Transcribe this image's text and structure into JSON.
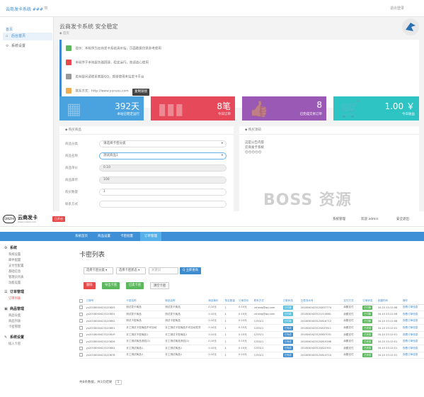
{
  "top_screen": {
    "header": {
      "logo": "云商发卡系统 ###",
      "menu_icon": "menu-icon",
      "right_text": "退出登录"
    },
    "sidebar": {
      "header": "首页",
      "items": [
        {
          "label": "后台首页",
          "active": true,
          "icon": "home-icon"
        },
        {
          "label": "系统设置",
          "active": false,
          "icon": "gear-icon"
        }
      ]
    },
    "page_title": "云商发卡系统 安全稳定",
    "breadcrumb": "◆ 首页",
    "notices": [
      {
        "text": "提示：本程序为云商发卡系统演示站，页面数据仅供参考使用",
        "color": "#5cb85c"
      },
      {
        "text": "本程序于本地服务器搭建，稳定运行，故请放心使用",
        "color": "#e64a4a"
      },
      {
        "text": "若有疑问请联系客服QQ，感谢使用本站发卡平台",
        "color": "#999999"
      },
      {
        "text": "联系方式：http://www.yunsos.com",
        "color": "#f0ad4e",
        "button": "复制链接"
      }
    ],
    "stats": [
      {
        "big": "392天",
        "small": "本站已稳定运行",
        "color": "#4aa3df",
        "icon": "calendar-icon"
      },
      {
        "big": "8笔",
        "small": "今日订单",
        "color": "#e64a5a",
        "icon": "chart-icon"
      },
      {
        "big": "8",
        "small": "已完成交易订单",
        "color": "#9b59b6",
        "icon": "thumb-icon"
      },
      {
        "big": "1.00 ￥",
        "small": "今日收益",
        "color": "#2ec4c4",
        "icon": "cart-icon"
      }
    ],
    "form_panel": {
      "title": "◆ 购买商品",
      "rows": [
        {
          "label": "商品分类",
          "value": "请选择卡密分类",
          "type": "select"
        },
        {
          "label": "商品名称",
          "value": "测试商品1",
          "type": "select-active"
        },
        {
          "label": "商品单价",
          "value": "0.10",
          "type": "grey"
        },
        {
          "label": "商品库存",
          "value": "100",
          "type": "grey"
        },
        {
          "label": "购买数量",
          "value": "1",
          "type": "input"
        },
        {
          "label": "联系方式",
          "value": "",
          "type": "input"
        }
      ]
    },
    "notice_panel": {
      "title": "◆ 购买须知",
      "lines": [
        "这是公告内容",
        "云商发卡系统",
        "😊😊😊😊😊"
      ]
    },
    "watermark": "BOSS 资源"
  },
  "bottom_screen": {
    "logo": {
      "box": "QINZHI",
      "name": "云商发卡",
      "url": "www.yunsos.com"
    },
    "red_tag": "已开启",
    "top_links": [
      "系统管理",
      "欢迎 admin",
      "安全退出"
    ],
    "nav": [
      {
        "label": "系统首页",
        "active": false
      },
      {
        "label": "商品设置",
        "active": false
      },
      {
        "label": "卡密批量",
        "active": false
      },
      {
        "label": "订单管理",
        "active": true
      }
    ],
    "sidebar": [
      {
        "title": "系统",
        "icon": "gear-icon",
        "items": [
          "系统设置",
          "邮件配置",
          "支付宝配置",
          "基础信息",
          "管理员列表",
          "功能设置"
        ]
      },
      {
        "title": "订单管理",
        "icon": "list-icon",
        "items": [
          "订单列表"
        ],
        "active_item": "订单列表"
      },
      {
        "title": "商品管理",
        "icon": "box-icon",
        "items": [
          "商品分类",
          "商品列表",
          "卡密管理"
        ]
      },
      {
        "title": "系统设置",
        "icon": "wrench-icon",
        "items": [
          "插入卡密"
        ]
      }
    ],
    "page_title": "卡密列表",
    "filters": {
      "select1": "选择卡密分类",
      "select2": "选择卡密状态",
      "keyword": "关键词",
      "search_button": "Q 立即查询"
    },
    "actions": [
      {
        "label": "删除",
        "color": "#e64a4a"
      },
      {
        "label": "导出卡密",
        "color": "#5cb85c"
      },
      {
        "label": "已卖卡密",
        "color": "#5cb85c"
      },
      {
        "label": "清空卡密",
        "color": "#f5f5f5"
      }
    ],
    "table": {
      "headers": [
        "",
        "订单号",
        "卡密名称",
        "商品名称",
        "商品单价",
        "购买数量",
        "订单总价",
        "联系方式",
        "订单状态",
        "交易流水号",
        "支付方式",
        "订单状态",
        "创建时间",
        "操作"
      ],
      "rows": [
        [
          "",
          "yu2018040423120833",
          "测试发卡商品",
          "测试发卡商品",
          "0.10元",
          "1",
          "0.10元",
          "cshang@qq.com",
          "已付款",
          "2018040423120837774",
          "余额支付",
          "已付款",
          "04-10 23:12:08",
          "查看订单信息"
        ],
        [
          "",
          "yu2018040423120831",
          "测试发卡商品",
          "测试发卡商品",
          "0.10元",
          "1",
          "0.10元",
          "cshang@qq.com",
          "已付款",
          "2018040423121114661",
          "余额支付",
          "已付款",
          "04-10 23:12:08",
          "查看订单信息"
        ],
        [
          "",
          "yu2018040423120852",
          "测试卡密商品",
          "测试卡密商品",
          "0.10元",
          "1",
          "0.10元",
          "123321",
          "已付款",
          "2018040423120816712",
          "余额支付",
          "已付款",
          "04-10 23:12:08",
          "查看订单信息"
        ],
        [
          "",
          "yu2018040423120851",
          "手工测试卡密商品不可自动",
          "手工测试卡密商品不可自动发货",
          "0.10元",
          "1",
          "0.10元",
          "123321",
          "已完成",
          "2018040423120837811",
          "余额支付",
          "已完成",
          "04-10 23:12:01",
          "查看订单信息"
        ],
        [
          "",
          "yu2018040423120819",
          "手工测试卡密商品1",
          "手工测试卡密商品1",
          "0.10元",
          "1",
          "0.10元",
          "123321",
          "已完成",
          "2018040423120807031",
          "余额支付",
          "已完成",
          "04-10 23:12:01",
          "查看订单信息"
        ],
        [
          "",
          "yu2018040423120826",
          "手工测试商品测试(2)",
          "手工测试商品测试(2)",
          "0.10元",
          "1",
          "0.10元",
          "123321",
          "已完成",
          "2018040423120810266",
          "余额支付",
          "已完成",
          "04-10 23:12:01",
          "查看订单信息"
        ],
        [
          "",
          "yu2018040423120841",
          "手工测试商品1",
          "手工测试商品1",
          "0.10元",
          "1",
          "0.10元",
          "123321",
          "已完成",
          "2018040423120822301",
          "余额支付",
          "已完成",
          "04-10 23:12:01",
          "查看订单信息"
        ],
        [
          "",
          "yu2018040423120878",
          "手工测试商品1",
          "手工测试商品1",
          "0.10元",
          "1",
          "0.10元",
          "123321",
          "已完成",
          "2018040423120814714",
          "余额支付",
          "已完成",
          "04-10 23:12:01",
          "查看订单信息"
        ]
      ]
    },
    "pager": {
      "text": "共8条数据，共1页结果",
      "page": "1"
    }
  }
}
